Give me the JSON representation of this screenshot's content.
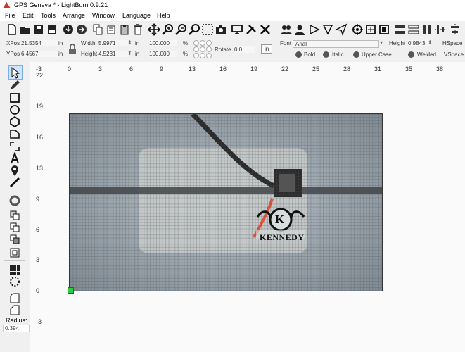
{
  "window": {
    "title": "GPS Geneva * - LightBurn 0.9.21"
  },
  "menu": [
    "File",
    "Edit",
    "Tools",
    "Arrange",
    "Window",
    "Language",
    "Help"
  ],
  "props": {
    "xpos_label": "XPos",
    "xpos": "21.5354",
    "ypos_label": "YPos",
    "ypos": "6.4567",
    "unit": "in",
    "width_label": "Width",
    "width": "5.9971",
    "height_label": "Height",
    "height": "4.5231",
    "scale_w": "100.000",
    "scale_h": "100.000",
    "pct": "%",
    "rotate_label": "Rotate",
    "rotate": "0.0",
    "in_btn": "in",
    "font_label": "Font",
    "font": "Arial",
    "fheight_label": "Height",
    "fheight": "0.9843",
    "hspace": "HSpace",
    "vspace": "VSpace",
    "bold": "Bold",
    "italic": "Italic",
    "upper": "Upper Case",
    "welded": "Welded"
  },
  "ruler": {
    "x": [
      "-3",
      "0",
      "3",
      "6",
      "9",
      "13",
      "16",
      "19",
      "22",
      "25",
      "28",
      "31",
      "35",
      "38"
    ],
    "y": [
      "22",
      "19",
      "16",
      "13",
      "9",
      "6",
      "3",
      "0",
      "-3"
    ]
  },
  "left": {
    "radius_label": "Radius:",
    "radius": "0.394"
  },
  "design": {
    "logo_letter": "K",
    "logo_text": "KENNEDY"
  }
}
